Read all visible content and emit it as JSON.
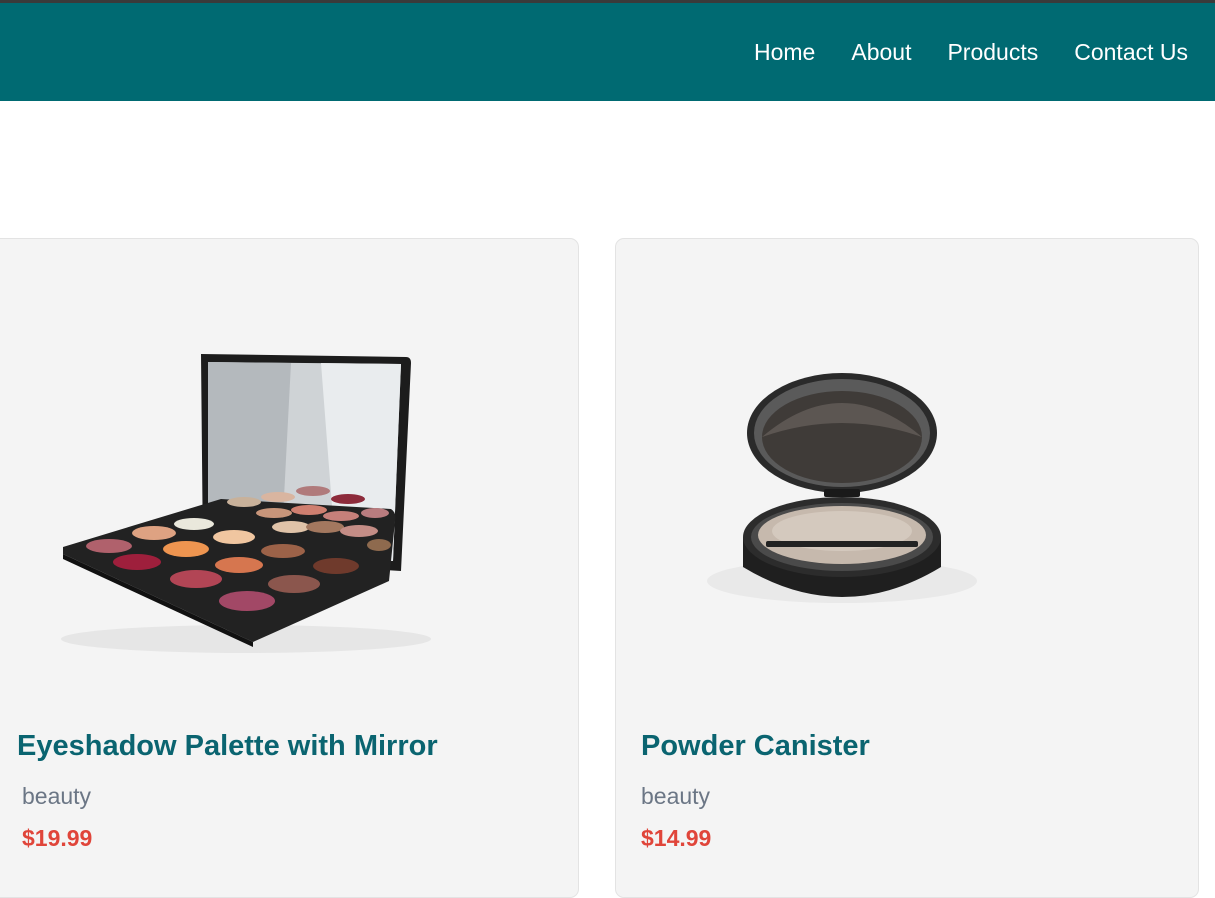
{
  "nav": {
    "items": [
      {
        "label": "Home"
      },
      {
        "label": "About"
      },
      {
        "label": "Products"
      },
      {
        "label": "Contact Us"
      }
    ]
  },
  "products": [
    {
      "title": "Eyeshadow Palette with Mirror",
      "category": "beauty",
      "price": "$19.99"
    },
    {
      "title": "Powder Canister",
      "category": "beauty",
      "price": "$14.99"
    }
  ],
  "colors": {
    "navbar": "#006a72",
    "title": "#0a6470",
    "price": "#e0453a",
    "category": "#6b7685"
  }
}
